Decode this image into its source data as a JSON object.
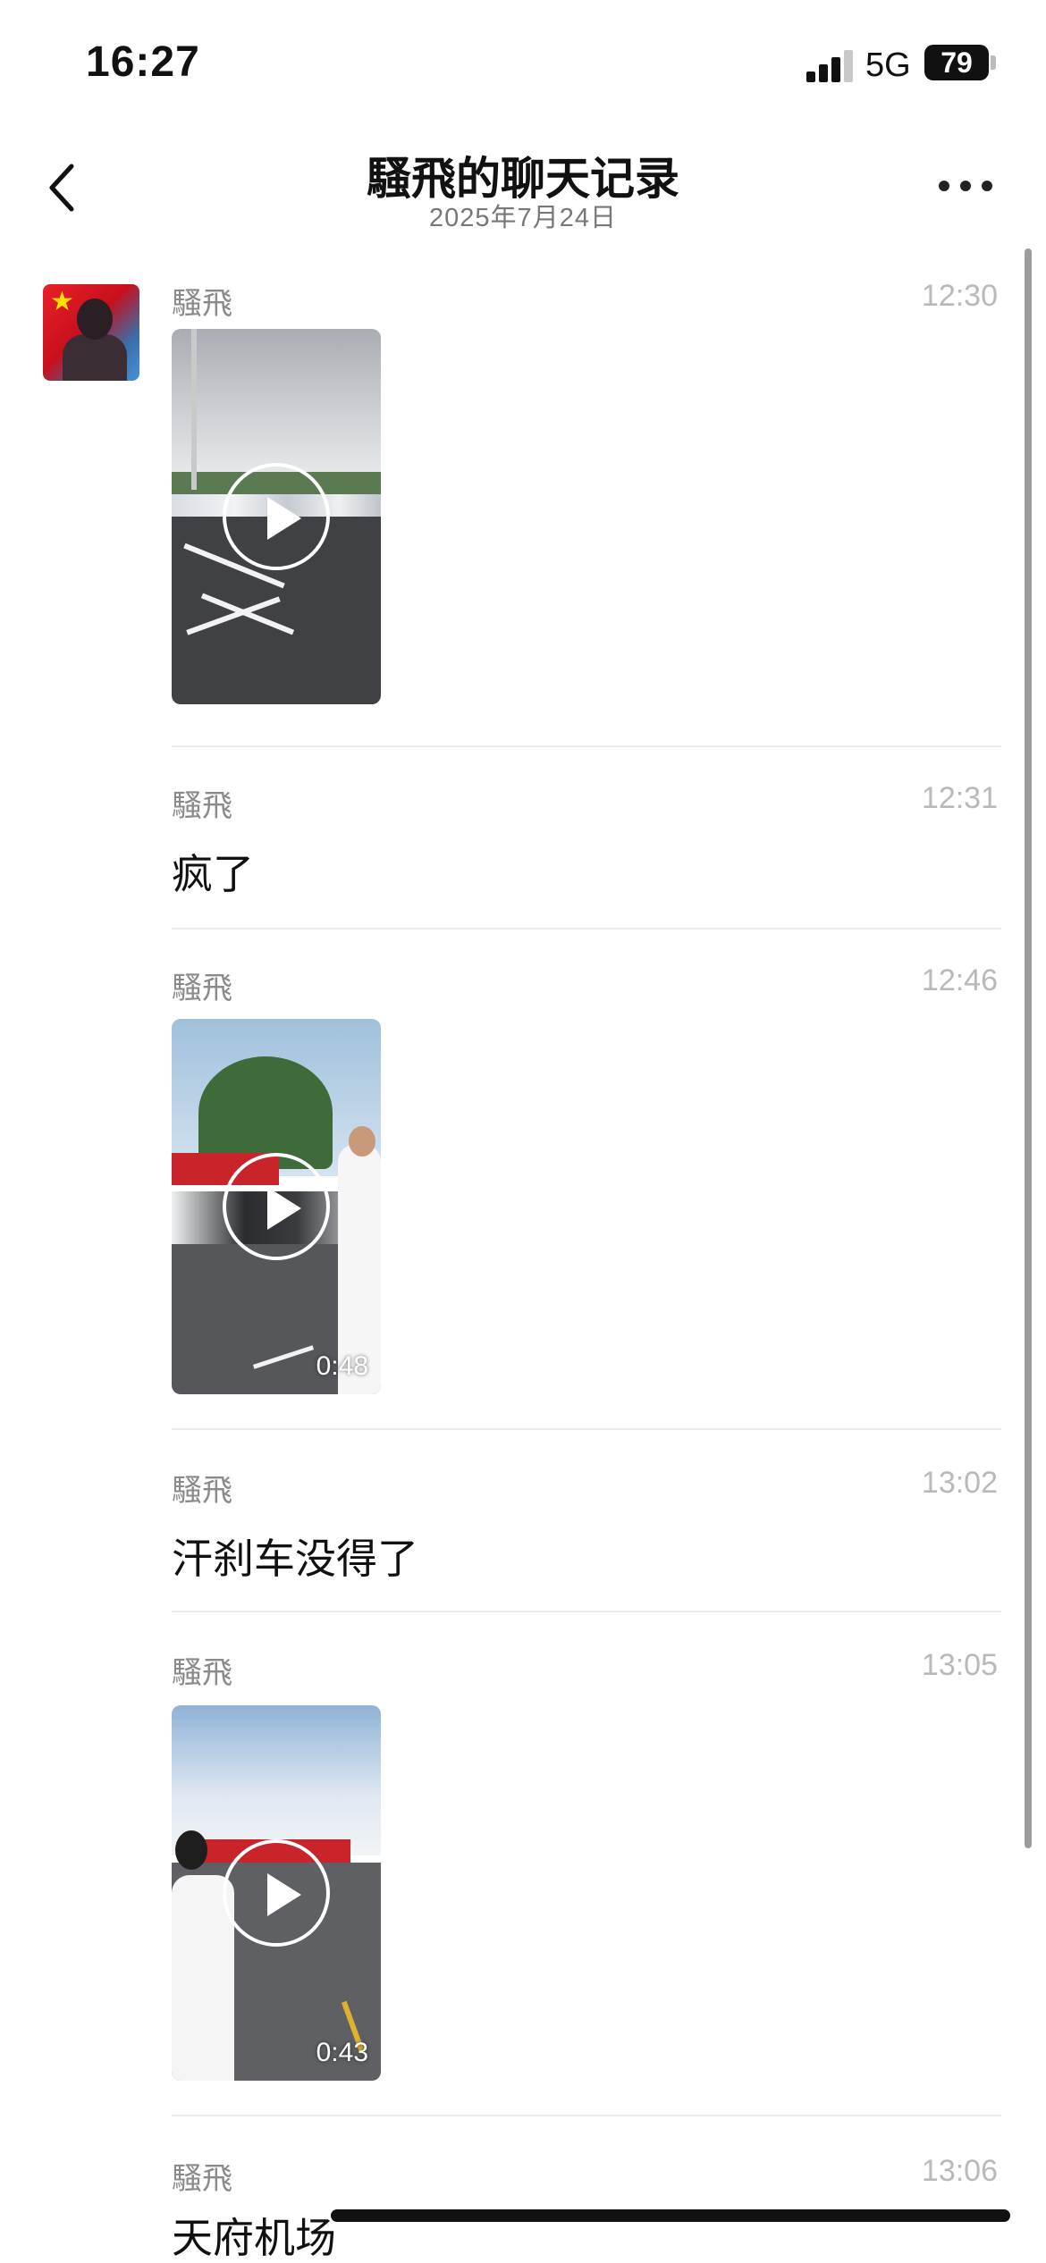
{
  "status_bar": {
    "time": "16:27",
    "network": "5G",
    "battery": "79"
  },
  "nav": {
    "title": "騷飛的聊天记录",
    "subtitle": "2025年7月24日"
  },
  "messages": [
    {
      "sender": "騷飛",
      "time": "12:30",
      "type": "video",
      "duration": ""
    },
    {
      "sender": "騷飛",
      "time": "12:31",
      "type": "text",
      "text": "疯了"
    },
    {
      "sender": "騷飛",
      "time": "12:46",
      "type": "video",
      "duration": "0:48"
    },
    {
      "sender": "騷飛",
      "time": "13:02",
      "type": "text",
      "text": "汗刹车没得了"
    },
    {
      "sender": "騷飛",
      "time": "13:05",
      "type": "video",
      "duration": "0:43"
    },
    {
      "sender": "騷飛",
      "time": "13:06",
      "type": "text",
      "text": "天府机场"
    }
  ],
  "icons": {
    "back": "chevron-left-icon",
    "more": "more-horizontal-icon",
    "play": "play-icon"
  }
}
